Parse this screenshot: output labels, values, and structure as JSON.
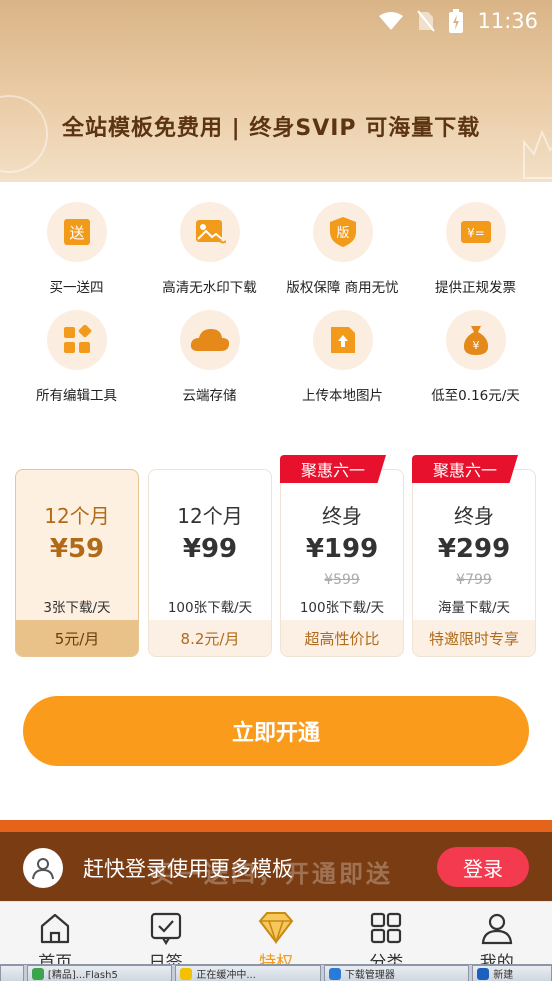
{
  "status_bar": {
    "time": "11:36"
  },
  "hero": {
    "title": "全站模板免费用 | 终身SVIP 可海量下载"
  },
  "benefits": [
    {
      "label": "买一送四",
      "icon": "gift-send-icon",
      "glyph": "送"
    },
    {
      "label": "高清无水印下载",
      "icon": "image-hd-icon",
      "glyph": ""
    },
    {
      "label": "版权保障 商用无忧",
      "icon": "copyright-shield-icon",
      "glyph": "版"
    },
    {
      "label": "提供正规发票",
      "icon": "invoice-icon",
      "glyph": "¥="
    },
    {
      "label": "所有编辑工具",
      "icon": "apps-grid-icon",
      "glyph": ""
    },
    {
      "label": "云端存储",
      "icon": "cloud-icon",
      "glyph": ""
    },
    {
      "label": "上传本地图片",
      "icon": "upload-file-icon",
      "glyph": ""
    },
    {
      "label": "低至0.16元/天",
      "icon": "money-bag-icon",
      "glyph": "¥"
    }
  ],
  "plans": [
    {
      "duration": "12个月",
      "price": "¥59",
      "original": "",
      "quota": "3张下载/天",
      "footer": "5元/月",
      "ribbon": "",
      "selected": true
    },
    {
      "duration": "12个月",
      "price": "¥99",
      "original": "",
      "quota": "100张下载/天",
      "footer": "8.2元/月",
      "ribbon": "",
      "selected": false
    },
    {
      "duration": "终身",
      "price": "¥199",
      "original": "¥599",
      "quota": "100张下载/天",
      "footer": "超高性价比",
      "ribbon": "聚惠六一",
      "selected": false
    },
    {
      "duration": "终身",
      "price": "¥299",
      "original": "¥799",
      "quota": "海量下载/天",
      "footer": "特邀限时专享",
      "ribbon": "聚惠六一",
      "selected": false
    }
  ],
  "cta": {
    "label": "立即开通"
  },
  "login_bar": {
    "message": "赶快登录使用更多模板",
    "ghost_text": "买一送四，开通即送",
    "button": "登录"
  },
  "nav": {
    "items": [
      {
        "label": "首页",
        "icon": "home-icon"
      },
      {
        "label": "日签",
        "icon": "calendar-check-icon"
      },
      {
        "label": "特权",
        "icon": "diamond-icon"
      },
      {
        "label": "分类",
        "icon": "category-grid-icon"
      },
      {
        "label": "我的",
        "icon": "profile-icon"
      }
    ],
    "active_index": 2
  },
  "taskbar": {
    "items": [
      "[精品]...Flash5",
      "正在缓冲中...",
      "下载管理器",
      "新建"
    ]
  },
  "colors": {
    "accent": "#fb9b1c",
    "ribbon": "#e8112d",
    "login_bg": "#7a3c12",
    "login_button": "#f33a4f",
    "selected_plan": "#fdf0e0"
  }
}
